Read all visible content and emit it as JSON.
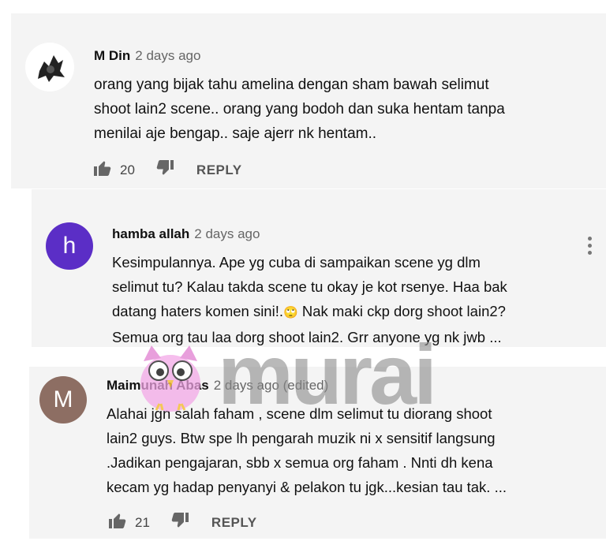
{
  "comments": [
    {
      "author": "M Din",
      "time": "2 days ago",
      "text": "orang yang bijak tahu amelina dengan sham bawah selimut\nshoot lain2 scene.. orang yang bodoh dan suka hentam tanpa\nmenilai aje bengap.. saje ajerr nk hentam..",
      "likes": "20",
      "reply_label": "REPLY"
    },
    {
      "author": "hamba allah",
      "time": "2 days ago",
      "avatar_letter": "h",
      "avatar_color": "#5b2ec6",
      "text": "Kesimpulannya. Ape yg cuba di sampaikan scene yg dlm\nselimut tu? Kalau takda scene tu okay je kot rsenye. Haa bak\ndatang haters komen sini!.",
      "text_emoji": "🙄",
      "text_after": " Nak maki ckp dorg shoot lain2?\nSemua org tau laa dorg shoot lain2.  Grr anyone yg nk jwb ..."
    },
    {
      "author": "Maimunah Abas",
      "time": "2 days ago (edited)",
      "avatar_letter": "M",
      "avatar_color": "#8d6e63",
      "text": "Alahai jgn salah faham , scene dlm selimut tu diorang shoot\nlain2 guys. Btw spe lh pengarah muzik ni x sensitif langsung\n.Jadikan pengajaran, sbb x semua org faham . Nnti dh kena\nkecam yg hadap penyanyi & pelakon tu jgk...kesian tau tak. ...",
      "likes": "21",
      "reply_label": "REPLY"
    }
  ],
  "watermark": {
    "text": "murai",
    "color": "#888888",
    "owl_color": "#f2a6e6"
  }
}
